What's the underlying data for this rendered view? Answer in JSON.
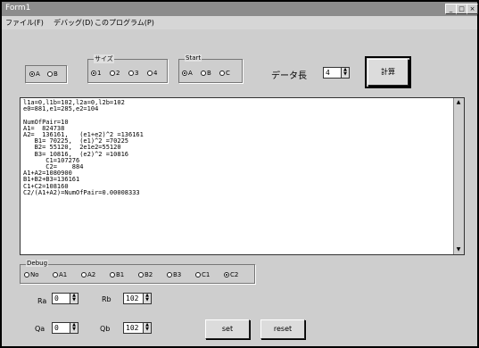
{
  "window": {
    "title": "Form1",
    "controls": [
      "_",
      "□",
      "×"
    ]
  },
  "menu": [
    {
      "label": "ファイル(F)"
    },
    {
      "label": "デバッグ(D)"
    },
    {
      "label": "このプログラム(P)"
    }
  ],
  "group_mode": {
    "options": [
      {
        "label": "A",
        "selected": true
      },
      {
        "label": "B",
        "selected": false
      }
    ]
  },
  "group_size": {
    "label": "サイズ",
    "options": [
      {
        "label": "1",
        "selected": true
      },
      {
        "label": "2",
        "selected": false
      },
      {
        "label": "3",
        "selected": false
      },
      {
        "label": "4",
        "selected": false
      }
    ]
  },
  "group_start": {
    "label": "Start",
    "options": [
      {
        "label": "A",
        "selected": true
      },
      {
        "label": "B",
        "selected": false
      },
      {
        "label": "C",
        "selected": false
      }
    ]
  },
  "data_length": {
    "label": "データ長",
    "value": "4"
  },
  "calc_button": {
    "label": "計算"
  },
  "output": {
    "lines": [
      "l1a=0,l1b=102,l2a=0,l2b=102",
      "e0=881,e1=285,e2=104",
      "",
      "NumOfPair=10",
      "A1=  824738",
      "A2=  136161,   (e1+e2)^2 =136161",
      "   B1= 70225,  (e1)^2 =70225",
      "   B2= 55120,  2e1e2=55120",
      "   B3= 10816,  (e2)^2 =10816",
      "      C1=107276",
      "      C2=    884",
      "A1+A2=1080900",
      "B1+B2+B3=136161",
      "C1+C2=108160",
      "C2/(A1+A2)=NumOfPair=0.00008333"
    ]
  },
  "debug": {
    "label": "Debug",
    "options": [
      {
        "label": "No",
        "selected": false
      },
      {
        "label": "A1",
        "selected": false
      },
      {
        "label": "A2",
        "selected": false
      },
      {
        "label": "B1",
        "selected": false
      },
      {
        "label": "B2",
        "selected": false
      },
      {
        "label": "B3",
        "selected": false
      },
      {
        "label": "C1",
        "selected": false
      },
      {
        "label": "C2",
        "selected": true
      }
    ]
  },
  "params": {
    "ra": {
      "label": "Ra",
      "value": "0"
    },
    "rb": {
      "label": "Rb",
      "value": "102"
    },
    "qa": {
      "label": "Qa",
      "value": "0"
    },
    "qb": {
      "label": "Qb",
      "value": "102"
    }
  },
  "buttons": {
    "set": "set",
    "reset": "reset"
  }
}
